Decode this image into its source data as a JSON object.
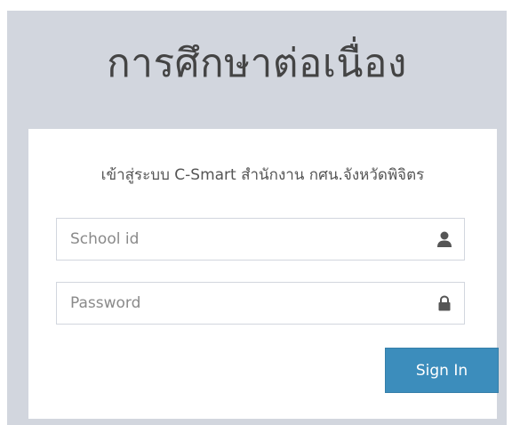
{
  "logo": {
    "title": "การศึกษาต่อเนื่อง"
  },
  "login": {
    "message": "เข้าสู่ระบบ C-Smart สำนักงาน กศน.จังหวัดพิจิตร",
    "school_id": {
      "placeholder": "School id",
      "value": "",
      "icon": "user-icon"
    },
    "password": {
      "placeholder": "Password",
      "value": "",
      "icon": "lock-icon"
    },
    "signin_label": "Sign In"
  },
  "colors": {
    "page_bg": "#d2d6de",
    "box_bg": "#ffffff",
    "button_bg": "#3c8dbc",
    "button_text": "#ffffff",
    "icon": "#555555"
  }
}
